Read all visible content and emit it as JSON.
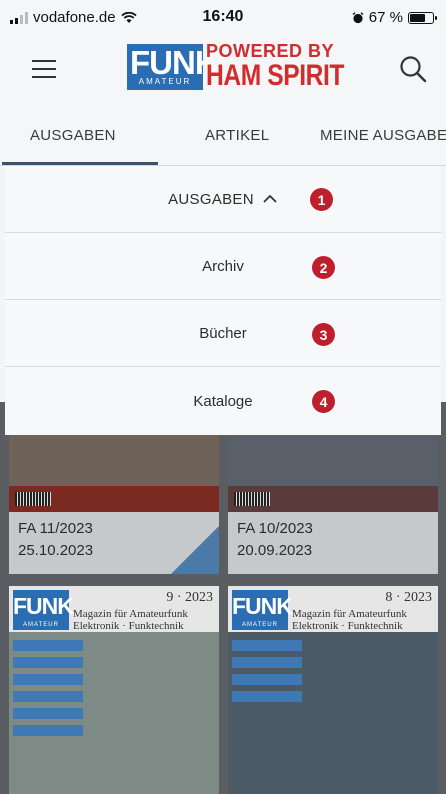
{
  "status_bar": {
    "carrier": "vodafone.de",
    "time": "16:40",
    "battery_percent": "67 %",
    "battery_level": 0.67
  },
  "header": {
    "logo_funk": "FUNK",
    "logo_amateur": "AMATEUR",
    "logo_powered_by": "POWERED BY",
    "logo_ham_spirit": "HAM SPIRIT"
  },
  "tabs": [
    {
      "label": "AUSGABEN"
    },
    {
      "label": "ARTIKEL"
    },
    {
      "label": "MEINE AUSGABE"
    }
  ],
  "dropdown": {
    "header_label": "AUSGABEN",
    "items": [
      {
        "label": "Archiv",
        "badge": "2"
      },
      {
        "label": "Bücher",
        "badge": "3"
      },
      {
        "label": "Kataloge",
        "badge": "4"
      }
    ],
    "header_badge": "1",
    "badge_color": "#bf1e2d"
  },
  "issues": [
    {
      "issue": "FA 11/2023",
      "date": "25.10.2023"
    },
    {
      "issue": "FA 10/2023",
      "date": "20.09.2023"
    }
  ],
  "magazines": [
    {
      "logo": "FUNK",
      "logo_sub": "AMATEUR",
      "subtitle_1": "Magazin für Amateurfunk",
      "subtitle_2": "Elektronik · Funktechnik",
      "number": "9 · 2023"
    },
    {
      "logo": "FUNK",
      "logo_sub": "AMATEUR",
      "subtitle_1": "Magazin für Amateurfunk",
      "subtitle_2": "Elektronik · Funktechnik",
      "number": "8 · 2023"
    }
  ]
}
